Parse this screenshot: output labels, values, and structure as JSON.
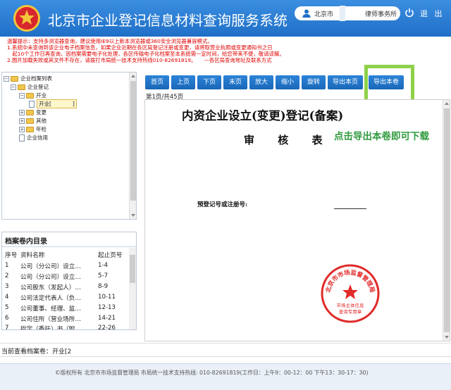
{
  "header": {
    "title": "北京市企业登记信息材料查询服务系统",
    "user_text": "北京市　　　　　律师事务所",
    "logout_label": "退 出"
  },
  "notice": {
    "lines": [
      "温馨提示：支持多浏览器查询，建议使用IE9以上新本浏览器或360安全浏览器兼容模式。",
      "1.系统中未查询到该企业电子档案信息，如果企业近期在各区局登记注册或变更，请将取营业执照或变更通知书之日",
      "　起10个工作日再查询，因档案需要电子化处理，各区传输电子化档案至本系统需一定时间，给您带来不便，敬请谅解。",
      "2.图片加载失败或其文件不存在，请拨打市局统一技术支持热线010-82691819。　　—各区局查询地址及联系方式"
    ]
  },
  "tree": {
    "root": "企业档案列表",
    "company": "企业登记",
    "kaiye": "开业",
    "leaf": "开业[　　　　]",
    "biangeng": "变更",
    "qita": "其他",
    "nianjian": "年检",
    "credit": "企业信用"
  },
  "catalog": {
    "title": "档案卷内目录",
    "headers": {
      "no": "序号",
      "name": "资料名称",
      "pages": "起止页号"
    },
    "rows": [
      {
        "no": "1",
        "name": "公司（分公司）设立…",
        "pages": "1-4"
      },
      {
        "no": "2",
        "name": "公司（分公司）设立…",
        "pages": "5-7"
      },
      {
        "no": "3",
        "name": "公司股东（发起人）…",
        "pages": "8-9"
      },
      {
        "no": "4",
        "name": "公司法定代表人（负…",
        "pages": "10-11"
      },
      {
        "no": "5",
        "name": "公司董事、经理、监…",
        "pages": "12-13"
      },
      {
        "no": "6",
        "name": "公司住所（营业场所…",
        "pages": "14-21"
      },
      {
        "no": "7",
        "name": "指定（委托）书（附…",
        "pages": "22-26"
      }
    ]
  },
  "toolbar": {
    "first": "首页",
    "prev": "上页",
    "next": "下页",
    "last": "末页",
    "zoom_in": "放大",
    "zoom_out": "缩小",
    "rotate": "旋转",
    "export_page": "导出本页",
    "export_volume": "导出本卷"
  },
  "page_info": "第1页/共45页",
  "document": {
    "title": "内资企业设立(变更)登记(备案)",
    "subtitle": "审 核 表",
    "reg_label": "预登记号或注册号:",
    "stamp_text": "北京市市场监督管理局",
    "stamp_sub1": "市场主体信息",
    "stamp_sub2": "查询专用章"
  },
  "annotation": "点击导出本卷即可下载",
  "current": {
    "label": "当前查看档案卷：开业[2"
  },
  "footer": {
    "text": "©版权所有 北京市市场监督管理局  市局统一技术支持热线: 010-82691819(工作日：上午9：00-12：00 下午13：30-17：30)"
  },
  "colors": {
    "header_blue": "#1f6fc7",
    "button_blue": "#1a67b8",
    "notice_red": "#e00000",
    "annotation_green": "#2f9a3d",
    "highlight_green": "#8fd14a",
    "stamp_red": "#e12a2a"
  }
}
